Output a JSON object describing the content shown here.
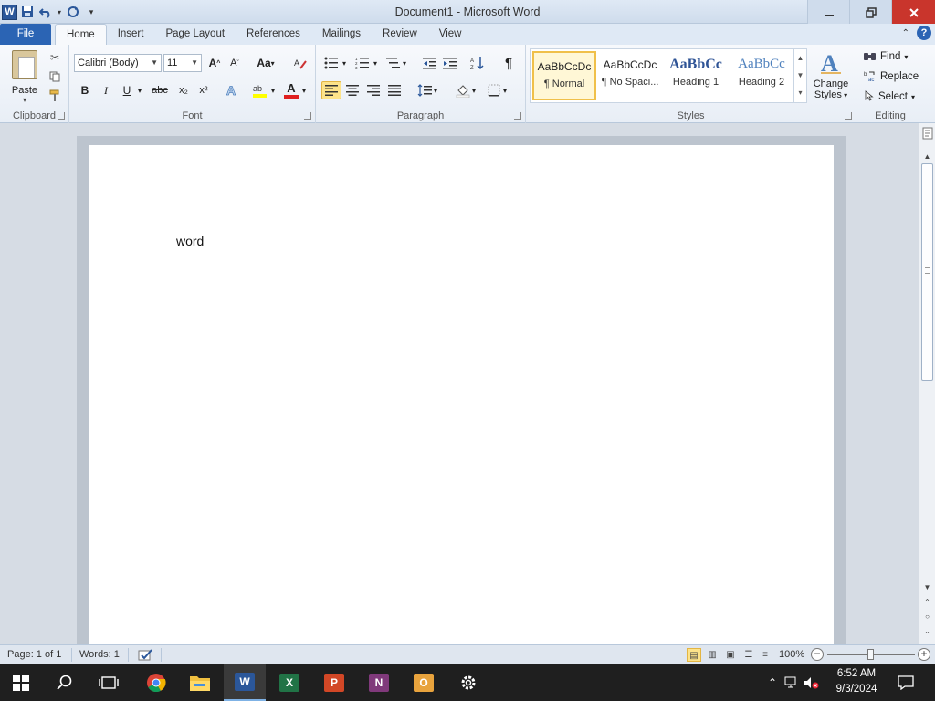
{
  "window": {
    "title": "Document1 - Microsoft Word",
    "app_icon_letter": "W"
  },
  "tabs": {
    "file": "File",
    "home": "Home",
    "insert": "Insert",
    "page_layout": "Page Layout",
    "references": "References",
    "mailings": "Mailings",
    "review": "Review",
    "view": "View",
    "help": "?"
  },
  "clipboard": {
    "paste_label": "Paste",
    "group_label": "Clipboard"
  },
  "font": {
    "family": "Calibri (Body)",
    "size": "11",
    "change_case": "Aa",
    "bold": "B",
    "italic": "I",
    "underline": "U",
    "strikethrough": "abc",
    "subscript": "x₂",
    "superscript": "x²",
    "font_color": "A",
    "group_label": "Font"
  },
  "paragraph": {
    "group_label": "Paragraph",
    "pilcrow": "¶"
  },
  "styles": {
    "items": [
      {
        "preview": "AaBbCcDc",
        "name": "¶ Normal"
      },
      {
        "preview": "AaBbCcDc",
        "name": "¶ No Spaci..."
      },
      {
        "preview": "AaBbCc",
        "name": "Heading 1"
      },
      {
        "preview": "AaBbCc",
        "name": "Heading 2"
      }
    ],
    "change_styles_line1": "Change",
    "change_styles_line2": "Styles",
    "group_label": "Styles"
  },
  "editing": {
    "find": "Find",
    "replace": "Replace",
    "select": "Select",
    "group_label": "Editing"
  },
  "document": {
    "text": "word"
  },
  "status": {
    "page": "Page: 1 of 1",
    "words": "Words: 1",
    "zoom": "100%"
  },
  "taskbar": {
    "excel_letter": "X",
    "powerpoint_letter": "P",
    "onenote_letter": "N",
    "outlook_letter": "O",
    "word_letter": "W",
    "time": "6:52 AM",
    "date": "9/3/2024"
  },
  "colors": {
    "file_tab": "#2b64b4",
    "word_blue": "#2b579a",
    "close_red": "#c9352c",
    "highlight_yellow": "#fde38a"
  }
}
